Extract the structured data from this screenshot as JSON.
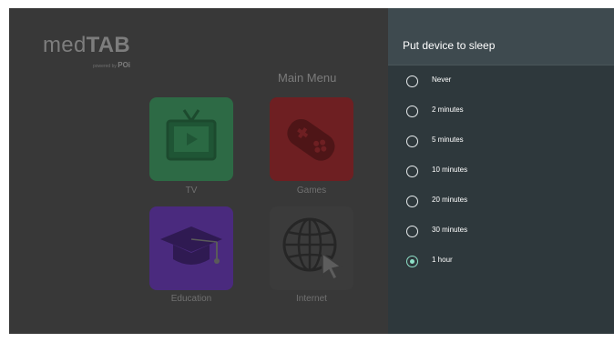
{
  "home": {
    "logo": {
      "brand_light": "med",
      "brand_bold": "TAB",
      "powered_by": "powered by",
      "powered_brand": "POi"
    },
    "menu_title": "Main Menu",
    "tiles": [
      {
        "label": "TV",
        "icon": "tv-icon",
        "color": "#2d6a45"
      },
      {
        "label": "Games",
        "icon": "gamepad-icon",
        "color": "#6e1f22"
      },
      {
        "label": "Education",
        "icon": "graduation-cap-icon",
        "color": "#4a2a7e"
      },
      {
        "label": "Internet",
        "icon": "globe-cursor-icon",
        "color": "#3b3b3b"
      }
    ]
  },
  "panel": {
    "title": "Put device to sleep",
    "options": [
      {
        "label": "Never",
        "checked": false
      },
      {
        "label": "2 minutes",
        "checked": false
      },
      {
        "label": "5 minutes",
        "checked": false
      },
      {
        "label": "10 minutes",
        "checked": false
      },
      {
        "label": "20 minutes",
        "checked": false
      },
      {
        "label": "30 minutes",
        "checked": false
      },
      {
        "label": "1 hour",
        "checked": true
      }
    ],
    "accent": "#8fe0c8"
  }
}
